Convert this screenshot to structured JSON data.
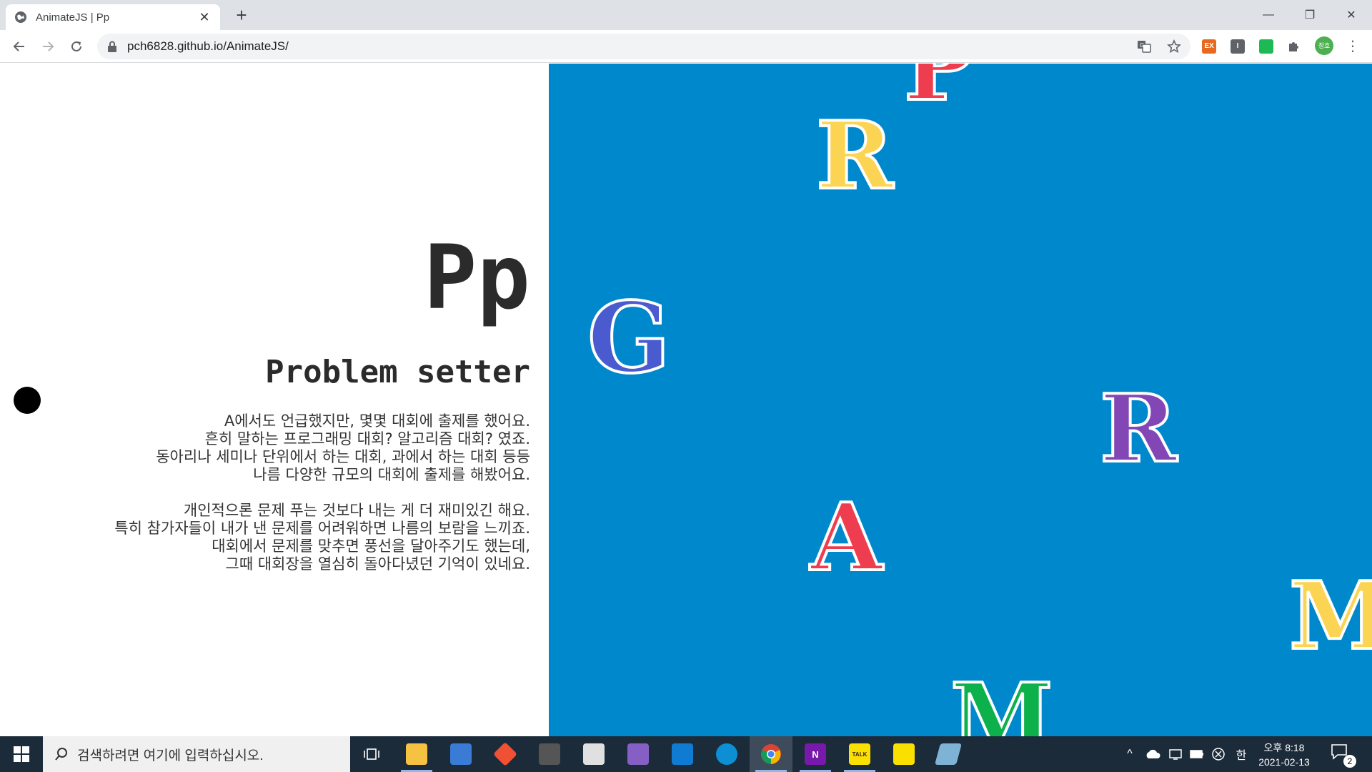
{
  "browser": {
    "tab_title": "AnimateJS | Pp",
    "new_tab": "+",
    "close_tab": "✕",
    "url": "pch6828.github.io/AnimateJS/",
    "extensions": [
      "EX",
      "I"
    ],
    "profile_label": "정호",
    "menu": "⋮",
    "window_controls": [
      "—",
      "❐",
      "✕"
    ]
  },
  "content": {
    "title": "Pp",
    "subtitle": "Problem setter",
    "paragraph1": [
      "A에서도 언급했지만, 몇몇 대회에 출제를 했어요.",
      "흔히 말하는 프로그래밍 대회? 알고리즘 대회? 였죠.",
      "동아리나 세미나 단위에서 하는 대회, 과에서 하는 대회 등등",
      "나름 다양한 규모의 대회에 출제를 해봤어요."
    ],
    "paragraph2": [
      "개인적으론 문제 푸는 것보다 내는 게 더 재미있긴 해요.",
      "특히 참가자들이 내가 낸 문제를 어려워하면 나름의 보람을 느끼죠.",
      "대회에서 문제를 맞추면 풍선을 달아주기도 했는데,",
      "그때 대회장을 열심히 돌아다녔던 기억이 있네요."
    ]
  },
  "letters": [
    {
      "char": "P",
      "color": "#ef3d50",
      "name": "letter-p"
    },
    {
      "char": "R",
      "color": "#fcd453",
      "name": "letter-r-yellow"
    },
    {
      "char": "G",
      "color": "#4a5bcf",
      "name": "letter-g"
    },
    {
      "char": "R",
      "color": "#8347b5",
      "name": "letter-r-purple"
    },
    {
      "char": "A",
      "color": "#ef3d50",
      "name": "letter-a"
    },
    {
      "char": "M",
      "color": "#fcd453",
      "name": "letter-m-yellow"
    },
    {
      "char": "M",
      "color": "#0db14b",
      "name": "letter-m-green"
    }
  ],
  "colors": {
    "right_panel_bg": "#0088cc",
    "text": "#2b2b2b"
  },
  "taskbar": {
    "search_placeholder": "검색하려면 여기에 입력하십시오.",
    "apps": [
      {
        "name": "file-explorer",
        "label": "",
        "color": "#f5c242"
      },
      {
        "name": "app-blue",
        "label": "",
        "color": "#3a7bd5"
      },
      {
        "name": "git",
        "label": "",
        "color": "#f05033"
      },
      {
        "name": "cube-app",
        "label": "",
        "color": "#555555"
      },
      {
        "name": "notepad-app",
        "label": "",
        "color": "#e0e0e0"
      },
      {
        "name": "visual-studio",
        "label": "",
        "color": "#865fc5"
      },
      {
        "name": "vscode",
        "label": "",
        "color": "#0f7bd3"
      },
      {
        "name": "edge",
        "label": "",
        "color": "#0c8fd3"
      },
      {
        "name": "chrome",
        "label": "",
        "color": "#db4437"
      },
      {
        "name": "onenote",
        "label": "N",
        "color": "#7719aa"
      },
      {
        "name": "kakaotalk",
        "label": "TALK",
        "color": "#f9e000"
      },
      {
        "name": "sticky-notes",
        "label": "",
        "color": "#f9e000"
      },
      {
        "name": "misc-app",
        "label": "",
        "color": "#7fb3d5"
      }
    ],
    "ime": "한",
    "clock_time": "오후 8:18",
    "clock_date": "2021-02-13",
    "notification_count": "2"
  }
}
